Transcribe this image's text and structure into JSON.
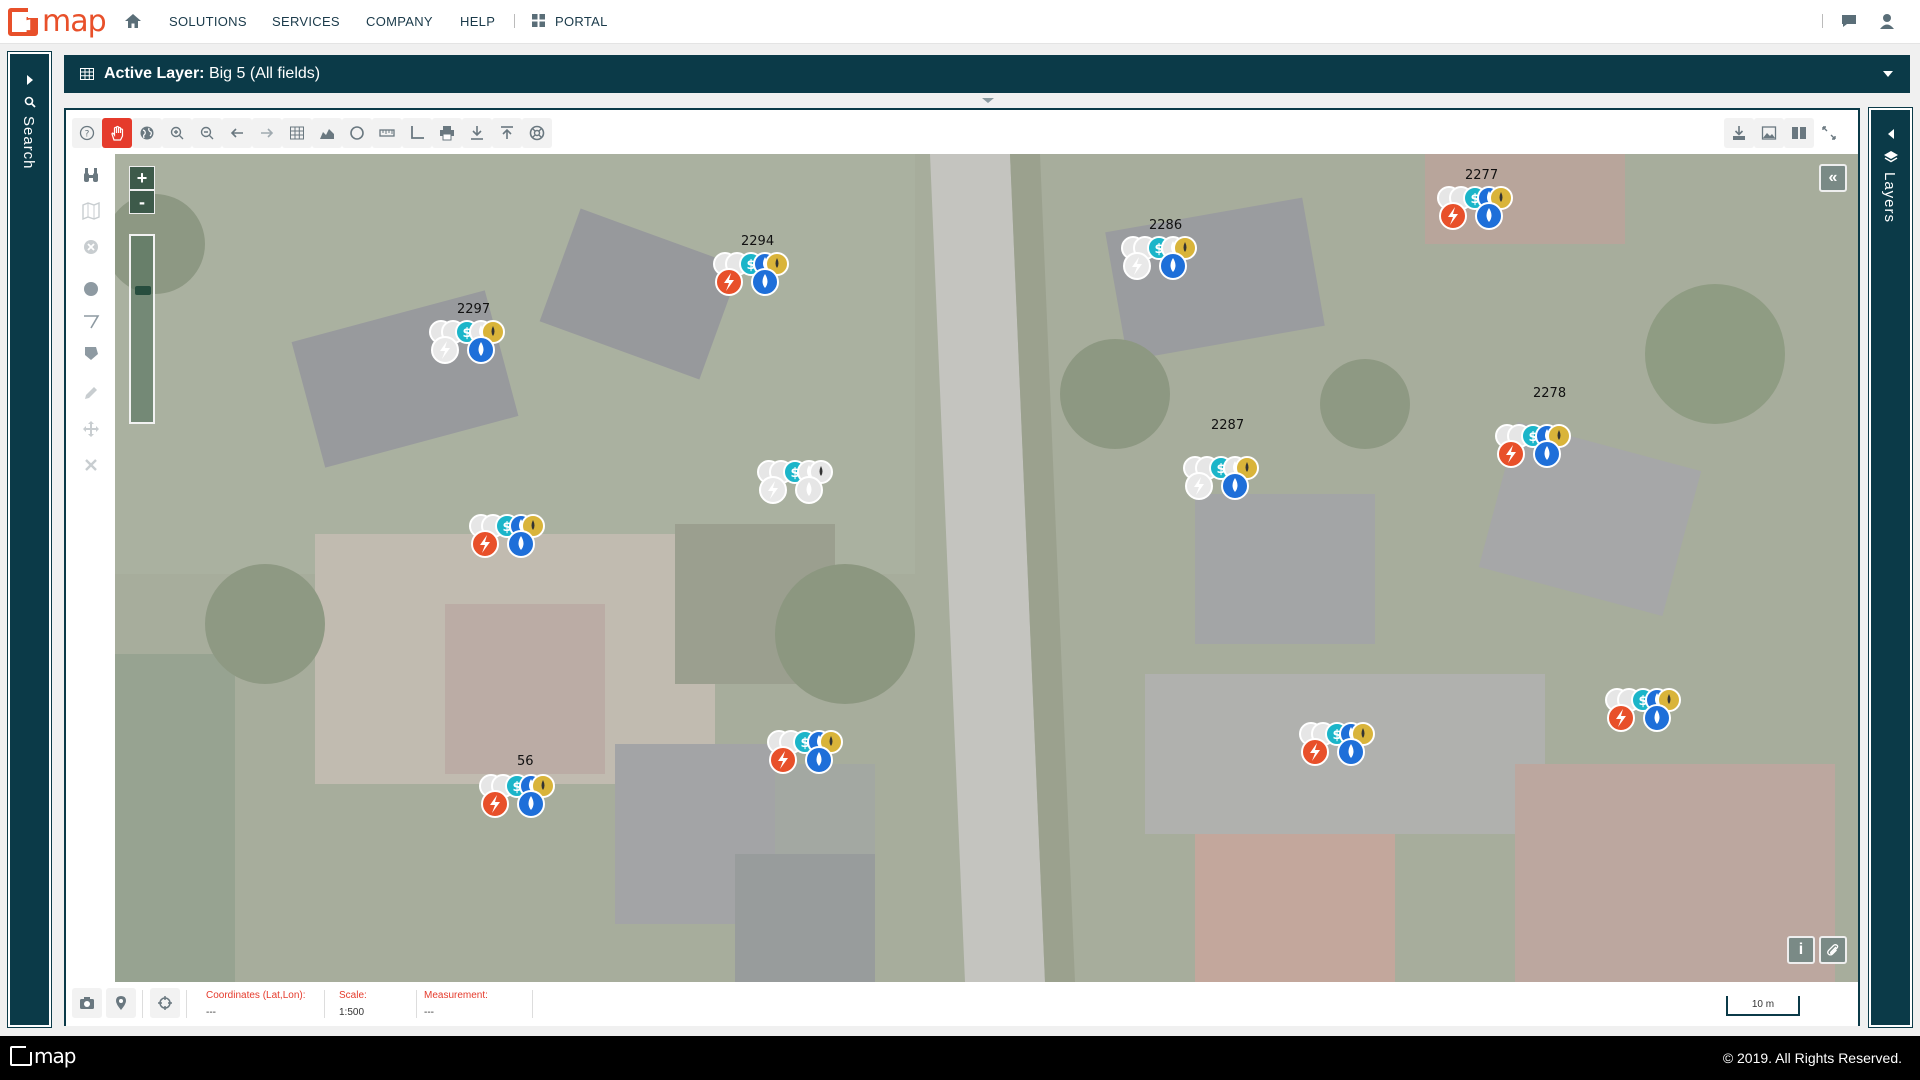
{
  "nav": {
    "brand": "map",
    "items": [
      "SOLUTIONS",
      "SERVICES",
      "COMPANY",
      "HELP"
    ],
    "portal": "PORTAL"
  },
  "left_panel": {
    "label": "Search"
  },
  "right_panel": {
    "label": "Layers"
  },
  "layer_bar": {
    "prefix": "Active Layer:",
    "name": "Big 5 (All fields)"
  },
  "toolbar": {
    "tools": [
      "help-icon",
      "pan-hand-icon",
      "globe-icon",
      "zoom-in-icon",
      "zoom-out-icon",
      "back-arrow-icon",
      "forward-arrow-icon",
      "table-icon",
      "chart-icon",
      "circle-icon",
      "ruler-icon",
      "angle-icon",
      "print-icon",
      "download-icon",
      "upload-icon",
      "support-icon"
    ],
    "active_tool": "pan-hand-icon",
    "right_tools": [
      "save-icon",
      "image-edit-icon",
      "columns-icon",
      "fullscreen-icon"
    ]
  },
  "map": {
    "zoom_in": "+",
    "zoom_out": "-",
    "collapse_button": "«",
    "info_button": "i",
    "parcels": [
      {
        "label": "2277"
      },
      {
        "label": "2294"
      },
      {
        "label": "2286"
      },
      {
        "label": "2297"
      },
      {
        "label": "2278"
      },
      {
        "label": "2287"
      },
      {
        "label": ""
      },
      {
        "label": ""
      },
      {
        "label": ""
      },
      {
        "label": ""
      },
      {
        "label": ""
      },
      {
        "label": "56"
      }
    ]
  },
  "status": {
    "coords_label": "Coordinates (Lat,Lon):",
    "coords_value": "---",
    "scale_label": "Scale:",
    "scale_value": "1:500",
    "measurement_label": "Measurement:",
    "measurement_value": "---",
    "scale_bar": "10 m"
  },
  "footer": {
    "brand": "map",
    "copyright": "© 2019. All Rights Reserved."
  },
  "colors": {
    "brand": "#e8502a",
    "panel": "#0b3a48",
    "active_tool": "#e53b2c",
    "electricity": "#e8502a",
    "water": "#1e6fd9",
    "payment": "#1bb5c9",
    "sewer": "#d9b43a"
  }
}
